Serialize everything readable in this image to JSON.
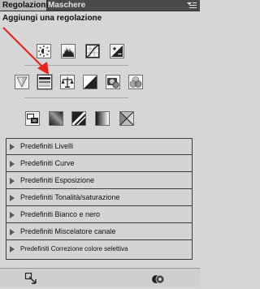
{
  "tabs": [
    {
      "label": "Regolazioni"
    },
    {
      "label": "Maschere"
    }
  ],
  "title": "Aggiungi una regolazione",
  "icons": {
    "row1": [
      "brightness-contrast-icon",
      "levels-icon",
      "curves-icon",
      "exposure-icon"
    ],
    "row2": [
      "vibrance-icon",
      "hue-saturation-icon",
      "color-balance-icon",
      "black-white-icon",
      "photo-filter-icon",
      "channel-mixer-icon"
    ],
    "row3": [
      "invert-icon",
      "posterize-icon",
      "threshold-icon",
      "gradient-map-icon",
      "selective-color-icon"
    ]
  },
  "presets": [
    {
      "label": "Predefiniti Livelli"
    },
    {
      "label": "Predefiniti Curve"
    },
    {
      "label": "Predefiniti Esposizione"
    },
    {
      "label": "Predefiniti Tonalità/saturazione"
    },
    {
      "label": "Predefiniti Bianco e nero"
    },
    {
      "label": "Predefiniti Miscelatore canale"
    },
    {
      "label": "Predefiniti Correzione colore selettiva"
    }
  ],
  "colors": {
    "annotation": "#e8221b",
    "panel_bg": "#d6d6d6"
  }
}
